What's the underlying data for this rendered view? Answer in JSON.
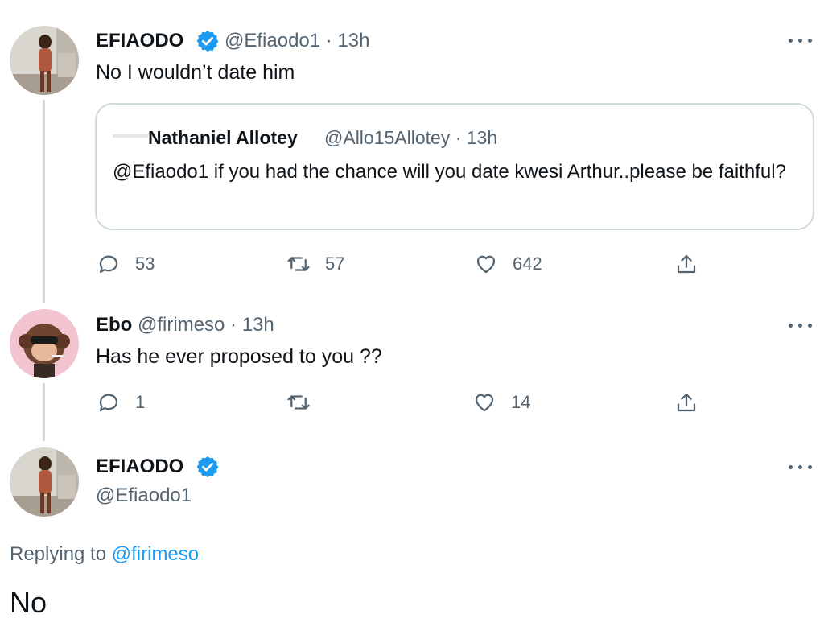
{
  "tweet1": {
    "display_name": "EFIAODO",
    "handle_time": "@Efiaodo1 · 13h",
    "text": "No I wouldn’t date him",
    "quote": {
      "display_name": "Nathaniel Allotey",
      "handle_time": "@Allo15Allotey · 13h",
      "text": "@Efiaodo1 if you had the chance will you date kwesi Arthur..please be faithful?"
    },
    "actions": {
      "replies": "53",
      "retweets": "57",
      "likes": "642"
    }
  },
  "tweet2": {
    "display_name": "Ebo",
    "handle_time": "@firimeso · 13h",
    "text": "Has he ever proposed to you ??",
    "actions": {
      "replies": "1",
      "retweets": "",
      "likes": "14"
    }
  },
  "tweet3": {
    "display_name": "EFIAODO",
    "handle": "@Efiaodo1",
    "replying_label": "Replying to",
    "replying_handle": "@firimeso",
    "text": "No"
  },
  "colors": {
    "link": "#1d9bf0",
    "verified": "#1d9bf0",
    "secondary_text": "#536471",
    "thread_line": "#cfd9de"
  },
  "icons": [
    "verified-badge-icon",
    "more-icon",
    "reply-icon",
    "retweet-icon",
    "like-icon",
    "share-icon"
  ]
}
